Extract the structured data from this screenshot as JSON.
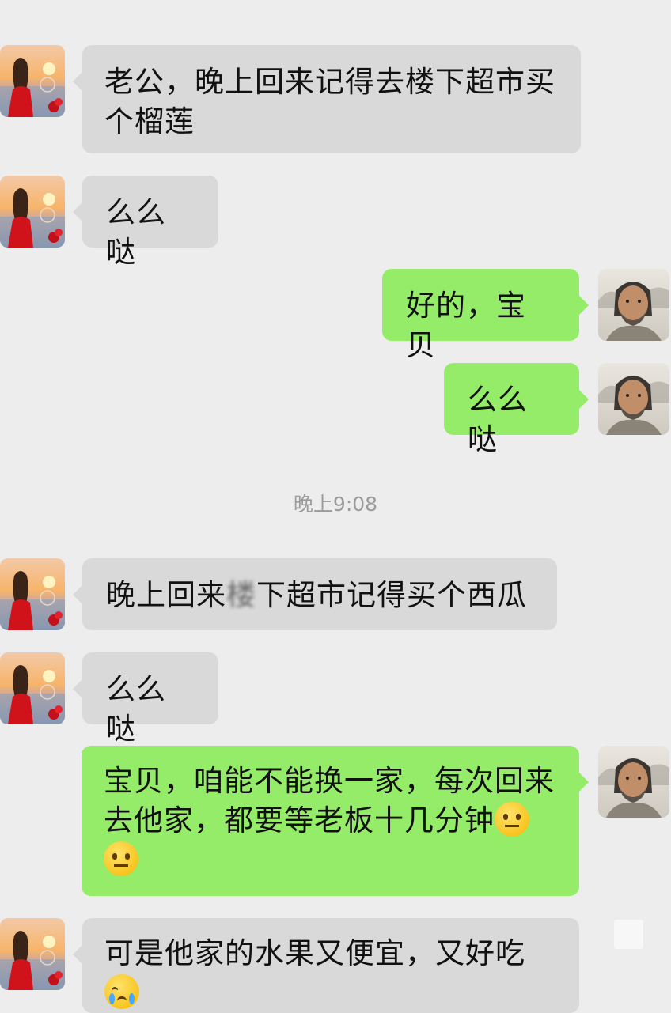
{
  "timestamp": "晚上9:08",
  "messages": [
    {
      "side": "left",
      "text": "老公，晚上回来记得去楼下超市买个榴莲"
    },
    {
      "side": "left",
      "text": "么么哒"
    },
    {
      "side": "right",
      "text": "好的，宝贝"
    },
    {
      "side": "right",
      "text": "么么哒"
    },
    {
      "side": "left",
      "text_a": "晚上回来",
      "text_blur": "楼",
      "text_b": "下超市记得买个西瓜"
    },
    {
      "side": "left",
      "text": "么么哒"
    },
    {
      "side": "right",
      "text_line1": "宝贝，咱能不能换一家，每次回来",
      "text_line2": "去他家，都要等老板十几分钟",
      "emojis": [
        "neutral-face-emoji",
        "neutral-face-emoji"
      ]
    },
    {
      "side": "left",
      "text": "可是他家的水果又便宜，又好吃",
      "emojis": [
        "crying-face-emoji"
      ]
    }
  ],
  "icons": {
    "female_avatar": "woman-red-dress-sunset-avatar",
    "male_avatar": "man-long-hair-beard-avatar"
  },
  "colors": {
    "background": "#ededed",
    "left_bubble": "#d9d9d9",
    "right_bubble": "#95ec69",
    "timestamp": "#9b9b9b"
  }
}
